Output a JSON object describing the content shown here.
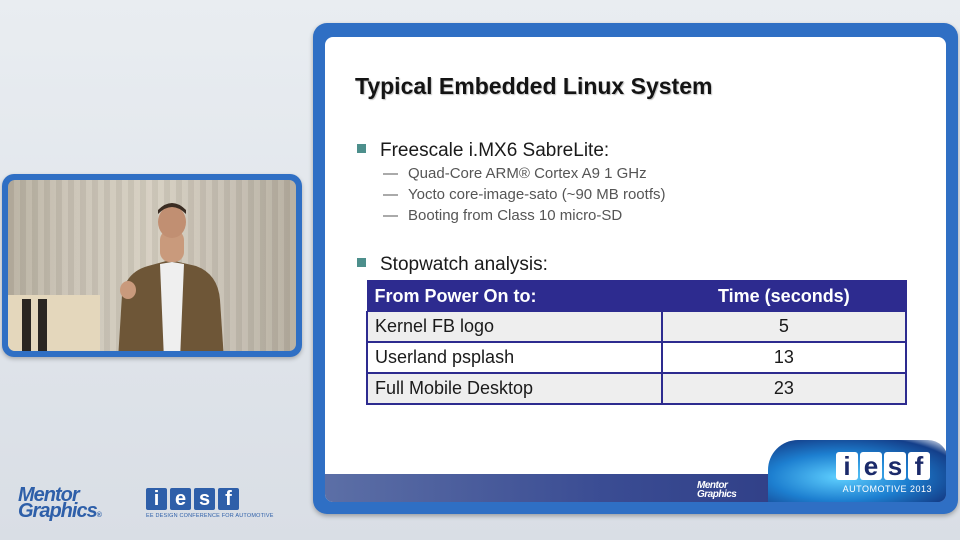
{
  "slide": {
    "title": "Typical Embedded Linux System",
    "bullets": [
      {
        "text": "Freescale i.MX6 SabreLite:",
        "subitems": [
          "Quad-Core ARM® Cortex A9 1 GHz",
          "Yocto core-image-sato (~90 MB rootfs)",
          "Booting from Class 10 micro-SD"
        ]
      },
      {
        "text": "Stopwatch analysis:",
        "subitems": []
      }
    ],
    "sub_dash": "—",
    "table": {
      "headers": [
        "From Power On to:",
        "Time (seconds)"
      ],
      "rows": [
        [
          "Kernel FB logo",
          "5"
        ],
        [
          "Userland psplash",
          "13"
        ],
        [
          "Full Mobile Desktop",
          "23"
        ]
      ]
    },
    "footer": {
      "logo_line1": "Mentor",
      "logo_line2": "Graphics",
      "badge_letters": [
        "i",
        "e",
        "s",
        "f"
      ],
      "badge_text": "AUTOMOTIVE 2013"
    }
  },
  "branding": {
    "mentor_line1": "Mentor",
    "mentor_line2": "Graphics",
    "mentor_reg": "®",
    "iesf_letters": [
      "i",
      "e",
      "s",
      "f"
    ],
    "iesf_tagline": "EE DESIGN CONFERENCE FOR AUTOMOTIVE"
  },
  "colors": {
    "frame_blue": "#2f6fc4",
    "table_header": "#2d2b8f",
    "bullet_square": "#4d8f8c"
  }
}
